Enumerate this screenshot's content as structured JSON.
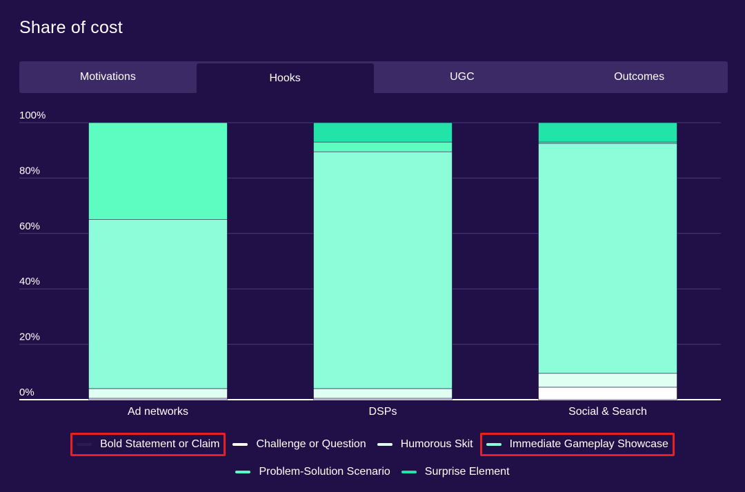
{
  "title": "Share of cost",
  "tabs": [
    {
      "label": "Motivations",
      "active": false
    },
    {
      "label": "Hooks",
      "active": true
    },
    {
      "label": "UGC",
      "active": false
    },
    {
      "label": "Outcomes",
      "active": false
    }
  ],
  "colors": {
    "background": "#210f47",
    "tab_bar": "#3b2a66",
    "grid": "#4a3a78",
    "axis": "#ffffff",
    "highlight_border": "#e8201f"
  },
  "legend_rows": [
    [
      0,
      1,
      2,
      3
    ],
    [
      4,
      5
    ]
  ],
  "chart_data": {
    "type": "bar",
    "stacked": true,
    "categories": [
      "Ad networks",
      "DSPs",
      "Social & Search"
    ],
    "y_ticks": [
      "0%",
      "20%",
      "40%",
      "60%",
      "80%",
      "100%"
    ],
    "ylim": [
      0,
      100
    ],
    "grid": true,
    "legend_position": "bottom",
    "series": [
      {
        "name": "Bold Statement or Claim",
        "color": "#2a1d55",
        "values": [
          0,
          0,
          0
        ],
        "highlighted": true
      },
      {
        "name": "Challenge or Question",
        "color": "#ffffff",
        "values": [
          0.5,
          0.5,
          4.5
        ],
        "highlighted": false
      },
      {
        "name": "Humorous Skit",
        "color": "#dffff3",
        "values": [
          3.5,
          3.5,
          5
        ],
        "highlighted": false
      },
      {
        "name": "Immediate Gameplay Showcase",
        "color": "#8dfcd8",
        "values": [
          61,
          85.5,
          83
        ],
        "highlighted": true
      },
      {
        "name": "Problem-Solution Scenario",
        "color": "#5dfdc2",
        "values": [
          35,
          3.5,
          0.5
        ],
        "highlighted": false
      },
      {
        "name": "Surprise Element",
        "color": "#22e3a8",
        "values": [
          0,
          7,
          7
        ],
        "highlighted": false
      }
    ]
  }
}
